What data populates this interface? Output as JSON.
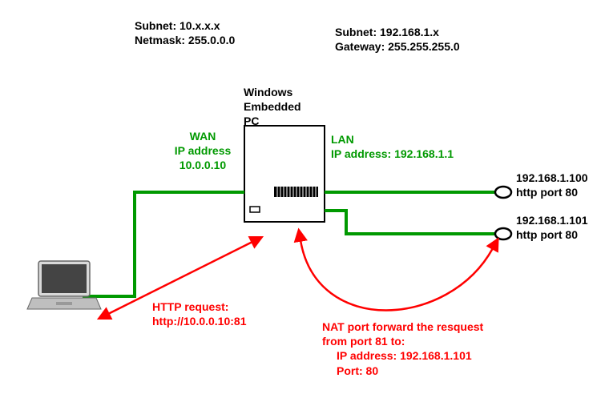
{
  "left_subnet": {
    "line1": "Subnet: 10.x.x.x",
    "line2": "Netmask: 255.0.0.0"
  },
  "right_subnet": {
    "line1": "Subnet: 192.168.1.x",
    "line2": "Gateway: 255.255.255.0"
  },
  "pc_title": {
    "line1": "Windows",
    "line2": "Embedded",
    "line3": "PC"
  },
  "wan": {
    "title": "WAN",
    "addr_label": "IP address",
    "addr_value": "10.0.0.10"
  },
  "lan": {
    "title": "LAN",
    "addr": "IP address: 192.168.1.1"
  },
  "host1": {
    "ip": "192.168.1.100",
    "port": "http port 80"
  },
  "host2": {
    "ip": "192.168.1.101",
    "port": "http port 80"
  },
  "http_request": {
    "title": "HTTP request:",
    "url": "http://10.0.0.10:81"
  },
  "nat": {
    "line1": "NAT port forward the resquest",
    "line2": "from port 81 to:",
    "line3": "IP address: 192.168.1.101",
    "line4": "Port: 80"
  },
  "colors": {
    "green": "#009900",
    "red": "#ff0000",
    "black": "#000000",
    "gray": "#cccccc"
  }
}
